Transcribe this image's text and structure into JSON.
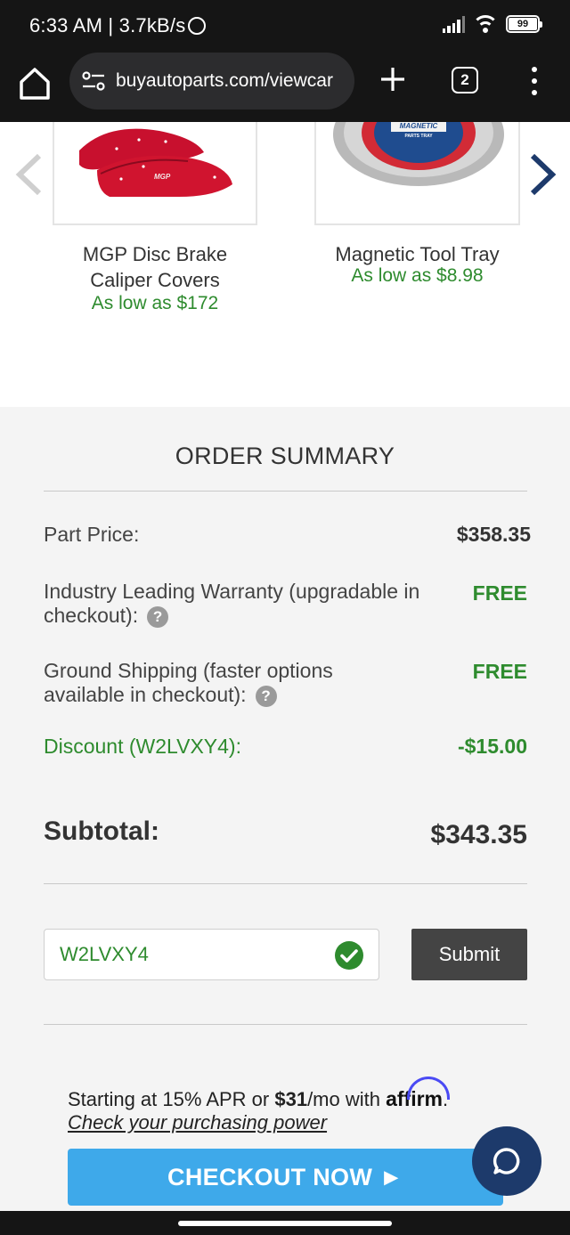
{
  "status_bar": {
    "time_speed": "6:33 AM | 3.7kB/s",
    "battery": "99"
  },
  "browser": {
    "url": "buyautoparts.com/viewcar",
    "tab_count": "2"
  },
  "carousel": {
    "products": [
      {
        "name_line1": "MGP Disc Brake",
        "name_line2": "Caliper Covers",
        "price": "As low as $172",
        "image_text": "MGP"
      },
      {
        "name_line1": "Magnetic Tool Tray",
        "name_line2": "",
        "price": "As low as $8.98",
        "image_text": "MAGNETIC",
        "image_subtext": "PARTS TRAY"
      }
    ]
  },
  "summary": {
    "title": "ORDER SUMMARY",
    "part_price_label": "Part Price:",
    "part_price_value": "$358.35",
    "warranty_label_line1": "Industry Leading Warranty (upgradable in",
    "warranty_label_line2": "checkout):",
    "warranty_value": "FREE",
    "shipping_label_line1": "Ground Shipping (faster options",
    "shipping_label_line2": "available in checkout):",
    "shipping_value": "FREE",
    "discount_label": "Discount (W2LVXY4):",
    "discount_value": "-$15.00",
    "subtotal_label": "Subtotal:",
    "subtotal_value": "$343.35",
    "help_glyph": "?"
  },
  "promo": {
    "code": "W2LVXY4",
    "submit_label": "Submit"
  },
  "affirm": {
    "prefix": "Starting at 15% APR or ",
    "amount": "$31",
    "suffix": "/mo with ",
    "logo": "affirm",
    "period": ".",
    "link": "Check your purchasing power"
  },
  "checkout": {
    "label": "CHECKOUT NOW ►"
  },
  "colors": {
    "green": "#2e8b2e",
    "checkout_blue": "#3ea9ea",
    "chat_navy": "#1d3a6b"
  }
}
